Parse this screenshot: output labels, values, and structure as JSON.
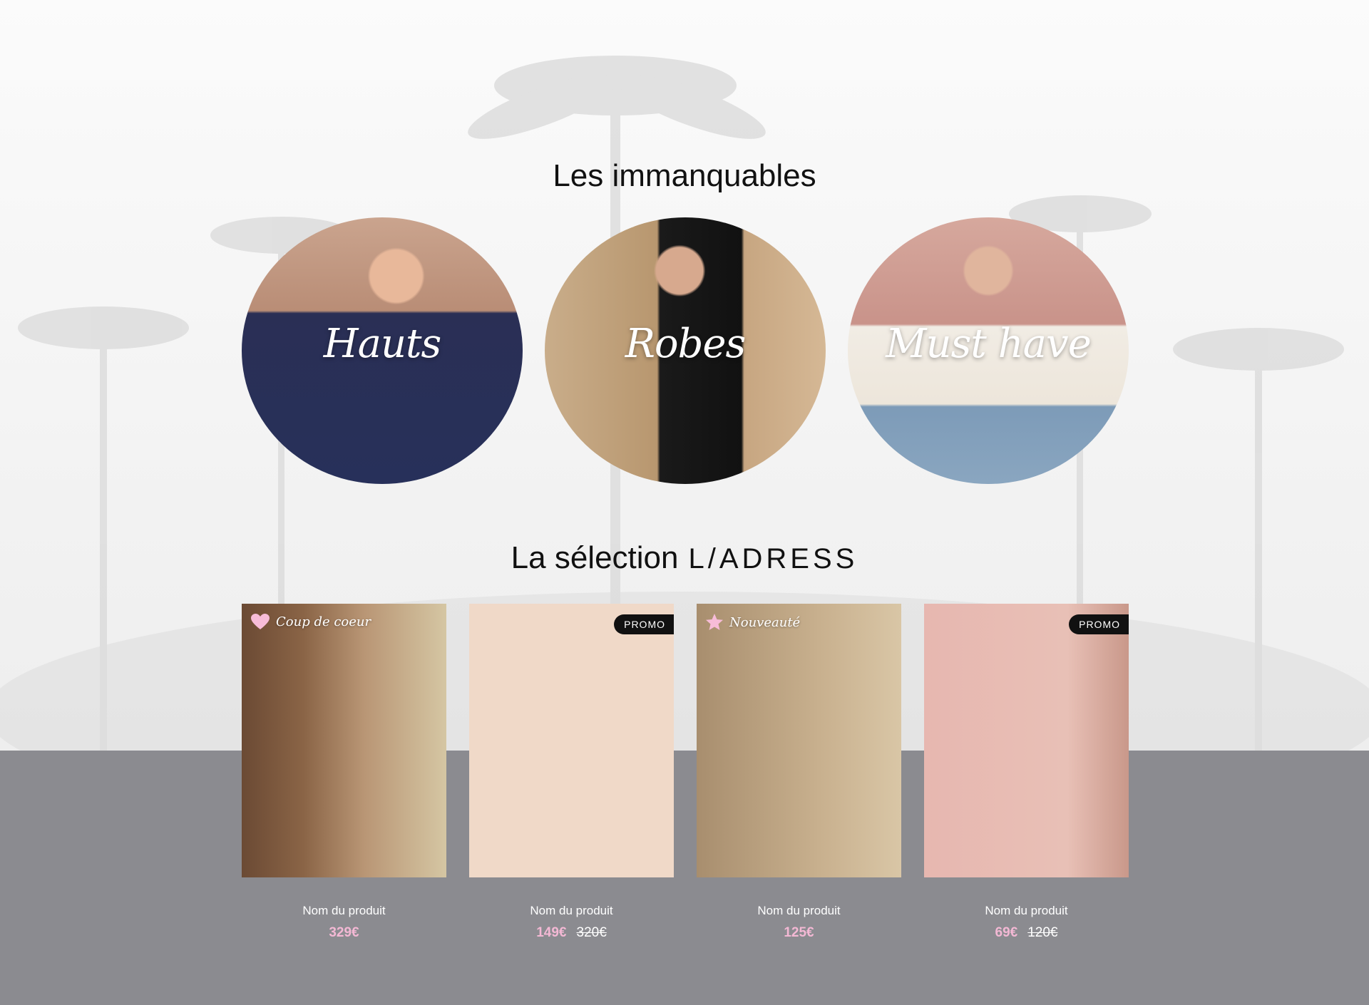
{
  "sections": {
    "categories_title": "Les immanquables",
    "selection_title": "La sélection",
    "selection_brand": "L/ADRESS"
  },
  "categories": [
    {
      "label": "Hauts"
    },
    {
      "label": "Robes"
    },
    {
      "label": "Must have"
    }
  ],
  "products": [
    {
      "badge": "Coup de coeur",
      "badge_icon": "heart-icon",
      "name": "Nom du produit",
      "price": "329€",
      "old_price": ""
    },
    {
      "badge": "PROMO",
      "badge_icon": "",
      "name": "Nom du produit",
      "price": "149€",
      "old_price": "320€"
    },
    {
      "badge": "Nouveauté",
      "badge_icon": "star-icon",
      "name": "Nom du produit",
      "price": "125€",
      "old_price": ""
    },
    {
      "badge": "PROMO",
      "badge_icon": "",
      "name": "Nom du produit",
      "price": "69€",
      "old_price": "120€"
    }
  ],
  "colors": {
    "price_accent": "#f3b8d4",
    "bottom_band": "#8b8b90",
    "promo_badge": "#111111"
  }
}
